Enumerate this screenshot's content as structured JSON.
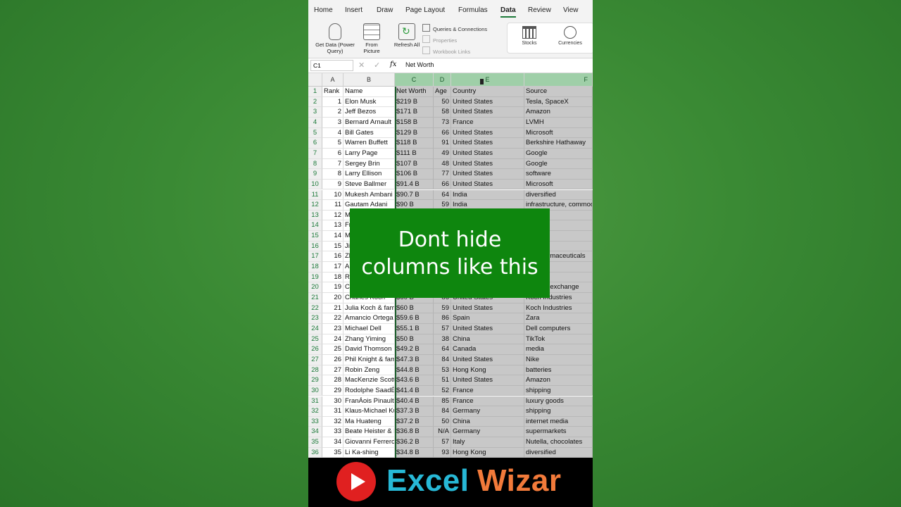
{
  "ribbon": {
    "tabs": [
      "Home",
      "Insert",
      "Draw",
      "Page Layout",
      "Formulas",
      "Data",
      "Review",
      "View"
    ],
    "active_tab": "Data",
    "get_data": "Get Data (Power Query)",
    "from_picture": "From Picture",
    "refresh_all": "Refresh All",
    "queries": "Queries & Connections",
    "properties": "Properties",
    "workbook_links": "Workbook Links",
    "stocks": "Stocks",
    "currencies": "Currencies"
  },
  "formula_bar": {
    "name_box": "C1",
    "fx": "fx",
    "content": "Net Worth"
  },
  "columns": [
    "A",
    "B",
    "C",
    "D",
    "E",
    "F"
  ],
  "headers": [
    "Rank",
    "Name",
    "Net Worth",
    "Age",
    "Country",
    "Source"
  ],
  "rows": [
    [
      "1",
      "Elon Musk",
      "$219 B",
      "50",
      "United States",
      "Tesla, SpaceX"
    ],
    [
      "2",
      "Jeff Bezos",
      "$171 B",
      "58",
      "United States",
      "Amazon"
    ],
    [
      "3",
      "Bernard Arnault",
      "$158 B",
      "73",
      "France",
      "LVMH"
    ],
    [
      "4",
      "Bill Gates",
      "$129 B",
      "66",
      "United States",
      "Microsoft"
    ],
    [
      "5",
      "Warren Buffett",
      "$118 B",
      "91",
      "United States",
      "Berkshire Hathaway"
    ],
    [
      "6",
      "Larry Page",
      "$111 B",
      "49",
      "United States",
      "Google"
    ],
    [
      "7",
      "Sergey Brin",
      "$107 B",
      "48",
      "United States",
      "Google"
    ],
    [
      "8",
      "Larry Ellison",
      "$106 B",
      "77",
      "United States",
      "software"
    ],
    [
      "9",
      "Steve Ballmer",
      "$91.4 B",
      "66",
      "United States",
      "Microsoft"
    ],
    [
      "10",
      "Mukesh Ambani",
      "$90.7 B",
      "64",
      "India",
      "diversified"
    ],
    [
      "11",
      "Gautam Adani",
      "$90 B",
      "59",
      "India",
      "infrastructure, commodities"
    ],
    [
      "12",
      "M",
      "",
      "",
      "",
      "erg LP"
    ],
    [
      "13",
      "Fr",
      "",
      "",
      "",
      ""
    ],
    [
      "14",
      "M",
      "",
      "",
      "",
      "ok"
    ],
    [
      "15",
      "Ji",
      "",
      "",
      "",
      "t"
    ],
    [
      "16",
      "Zh",
      "",
      "",
      "",
      "es, pharmaceuticals"
    ],
    [
      "17",
      "Al",
      "",
      "",
      "",
      "t"
    ],
    [
      "18",
      "Ro",
      "",
      "",
      "",
      "t"
    ],
    [
      "19",
      "Cl",
      "",
      "",
      "",
      "urrency exchange"
    ],
    [
      "20",
      "Charles Koch",
      "$60 B",
      "86",
      "United States",
      "Koch Industries"
    ],
    [
      "21",
      "Julia Koch & family",
      "$60 B",
      "59",
      "United States",
      "Koch Industries"
    ],
    [
      "22",
      "Amancio Ortega",
      "$59.6 B",
      "86",
      "Spain",
      "Zara"
    ],
    [
      "23",
      "Michael Dell",
      "$55.1 B",
      "57",
      "United States",
      "Dell computers"
    ],
    [
      "24",
      "Zhang Yiming",
      "$50 B",
      "38",
      "China",
      "TikTok"
    ],
    [
      "25",
      "David Thomson",
      "$49.2 B",
      "64",
      "Canada",
      "media"
    ],
    [
      "26",
      "Phil Knight & family",
      "$47.3 B",
      "84",
      "United States",
      "Nike"
    ],
    [
      "27",
      "Robin Zeng",
      "$44.8 B",
      "53",
      "Hong Kong",
      "batteries"
    ],
    [
      "28",
      "MacKenzie Scott",
      "$43.6 B",
      "51",
      "United States",
      "Amazon"
    ],
    [
      "29",
      "Rodolphe SaadÈ",
      "$41.4 B",
      "52",
      "France",
      "shipping"
    ],
    [
      "30",
      "FranÁois Pinault",
      "$40.4 B",
      "85",
      "France",
      "luxury goods"
    ],
    [
      "31",
      "Klaus-Michael Kuehne",
      "$37.3 B",
      "84",
      "Germany",
      "shipping"
    ],
    [
      "32",
      "Ma Huateng",
      "$37.2 B",
      "50",
      "China",
      "internet media"
    ],
    [
      "33",
      "Beate Heister & Karl Albrecht Jr.",
      "$36.8 B",
      "N/A",
      "Germany",
      "supermarkets"
    ],
    [
      "34",
      "Giovanni Ferrero",
      "$36.2 B",
      "57",
      "Italy",
      "Nutella, chocolates"
    ],
    [
      "35",
      "Li Ka-shing",
      "$34.8 B",
      "93",
      "Hong Kong",
      "diversified"
    ]
  ],
  "overlay": {
    "line1": "Dont hide",
    "line2": "columns like this"
  },
  "banner": {
    "word1": "Excel",
    "word2": "Wizar"
  },
  "colors": {
    "background": "#3a8a34",
    "excel_green": "#1d7a3a",
    "overlay": "#0e860e",
    "banner_blue": "#27b8d6",
    "banner_orange": "#f27a3a",
    "youtube_red": "#e02020"
  }
}
